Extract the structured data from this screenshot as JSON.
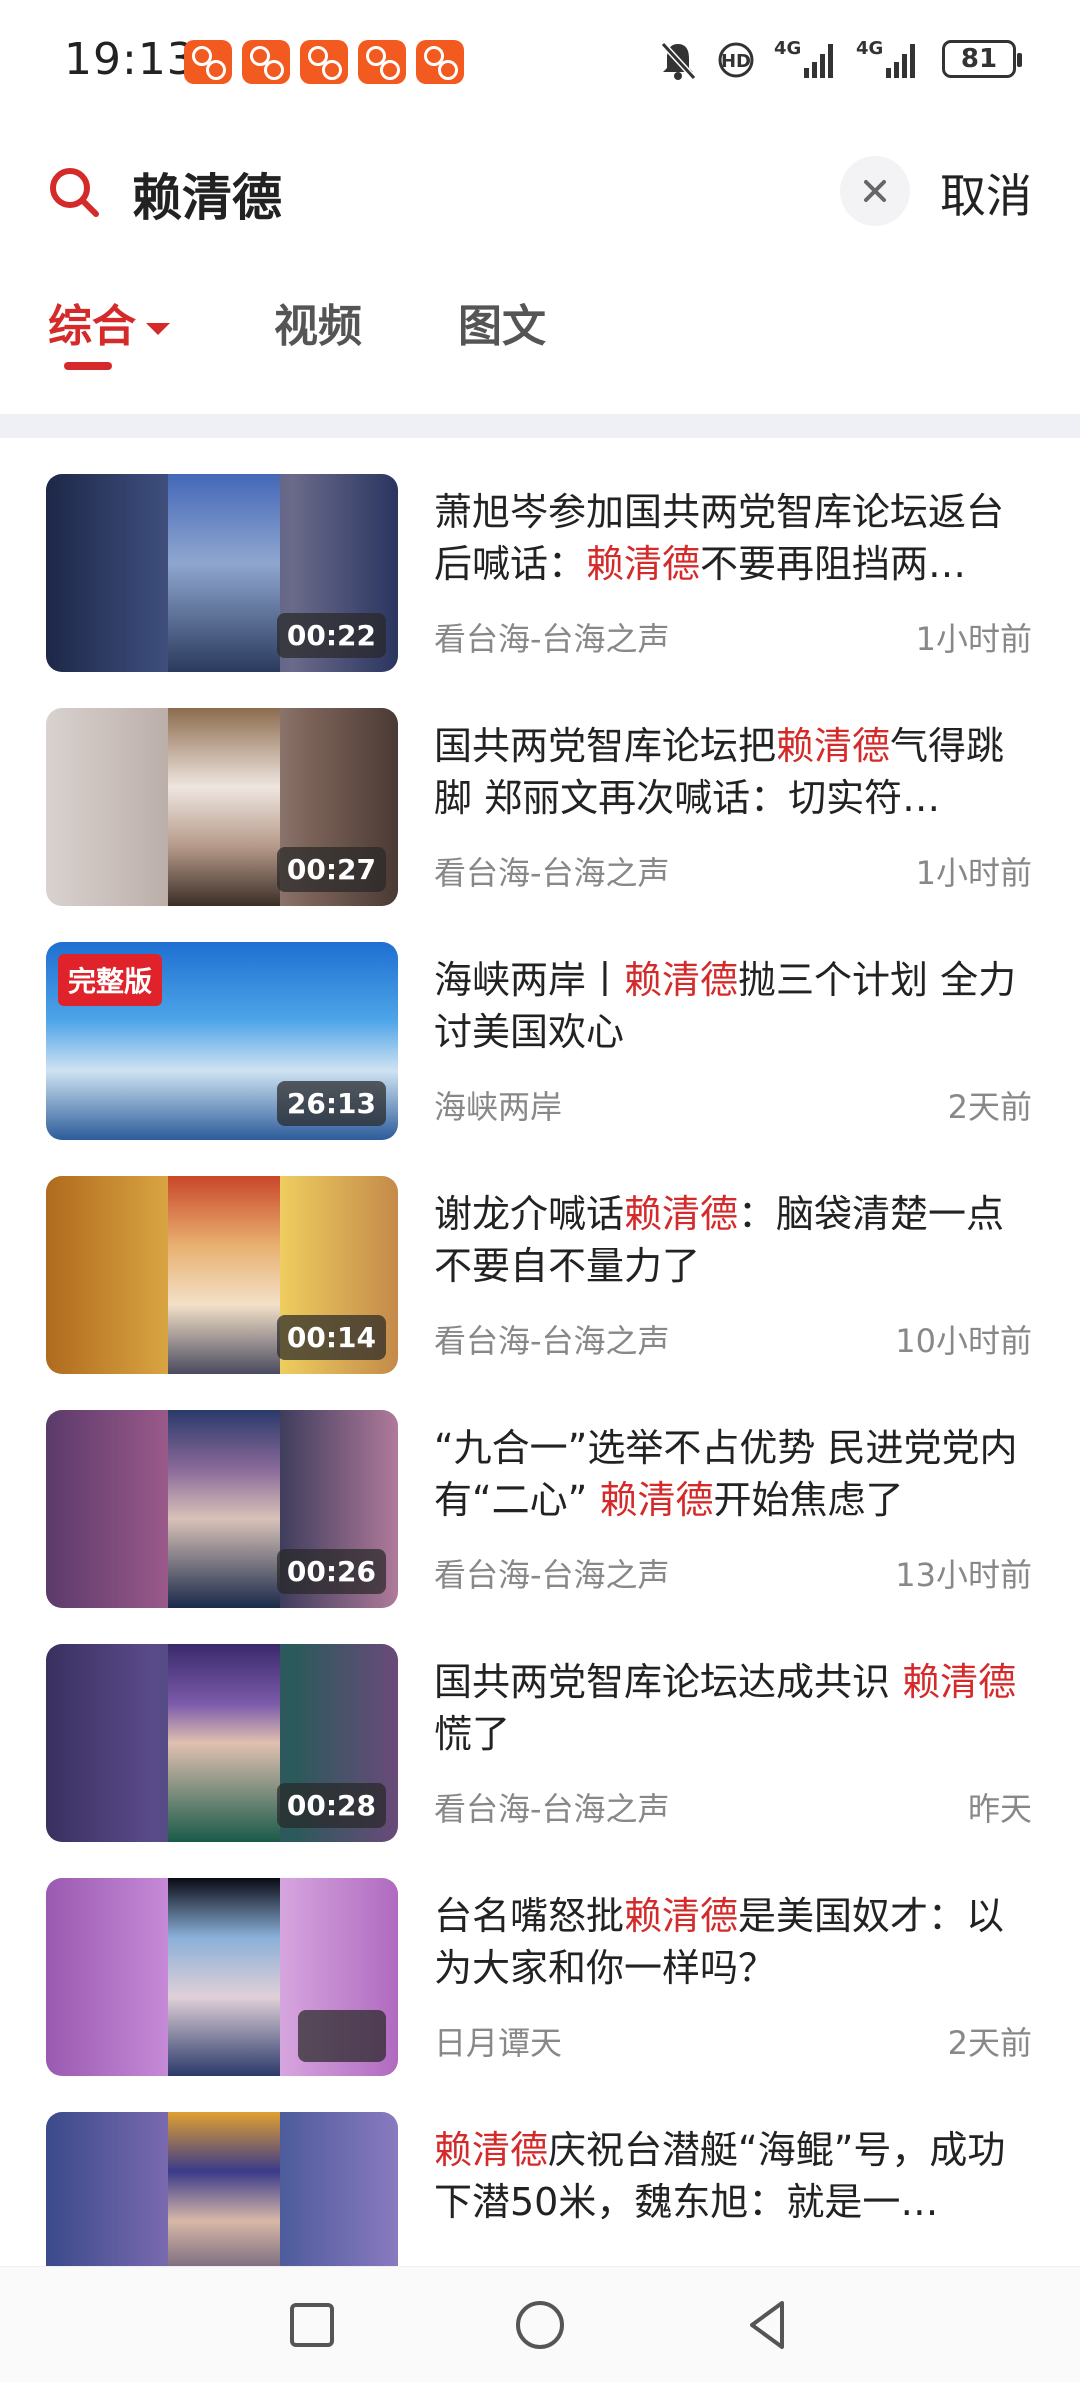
{
  "status_bar": {
    "time": "19:13",
    "notification_count": 5,
    "network_1": "4G",
    "network_2": "4G",
    "battery": "81"
  },
  "search": {
    "query": "赖清德",
    "cancel_label": "取消"
  },
  "tabs": [
    {
      "label": "综合",
      "active": true
    },
    {
      "label": "视频",
      "active": false
    },
    {
      "label": "图文",
      "active": false
    }
  ],
  "colors": {
    "accent": "#d42a2a",
    "meta_text": "#888888"
  },
  "results": [
    {
      "title_pre": "萧旭岑参加国共两党智库论坛返台后喊话：",
      "highlight": "赖清德",
      "title_post": "不要再阻挡两…",
      "source": "看台海-台海之声",
      "time": "1小时前",
      "duration": "00:22",
      "badge": ""
    },
    {
      "title_pre": "国共两党智库论坛把",
      "highlight": "赖清德",
      "title_post": "气得跳脚 郑丽文再次喊话：切实符…",
      "source": "看台海-台海之声",
      "time": "1小时前",
      "duration": "00:27",
      "badge": ""
    },
    {
      "title_pre": "海峡两岸丨",
      "highlight": "赖清德",
      "title_post": "抛三个计划 全力讨美国欢心",
      "source": "海峡两岸",
      "time": "2天前",
      "duration": "26:13",
      "badge": "完整版"
    },
    {
      "title_pre": "谢龙介喊话",
      "highlight": "赖清德",
      "title_post": "：脑袋清楚一点 不要自不量力了",
      "source": "看台海-台海之声",
      "time": "10小时前",
      "duration": "00:14",
      "badge": ""
    },
    {
      "title_pre": "“九合一”选举不占优势 民进党党内有“二心” ",
      "highlight": "赖清德",
      "title_post": "开始焦虑了",
      "source": "看台海-台海之声",
      "time": "13小时前",
      "duration": "00:26",
      "badge": ""
    },
    {
      "title_pre": "国共两党智库论坛达成共识 ",
      "highlight": "赖清德",
      "title_post": "慌了",
      "source": "看台海-台海之声",
      "time": "昨天",
      "duration": "00:28",
      "badge": ""
    },
    {
      "title_pre": "台名嘴怒批",
      "highlight": "赖清德",
      "title_post": "是美国奴才：以为大家和你一样吗？",
      "source": "日月谭天",
      "time": "2天前",
      "duration": "",
      "badge": ""
    },
    {
      "title_pre": "",
      "highlight": "赖清德",
      "title_post": "庆祝台潜艇“海鲲”号，成功下潜50米，魏东旭：就是一…",
      "source": "",
      "time": "",
      "duration": "",
      "badge": ""
    }
  ]
}
